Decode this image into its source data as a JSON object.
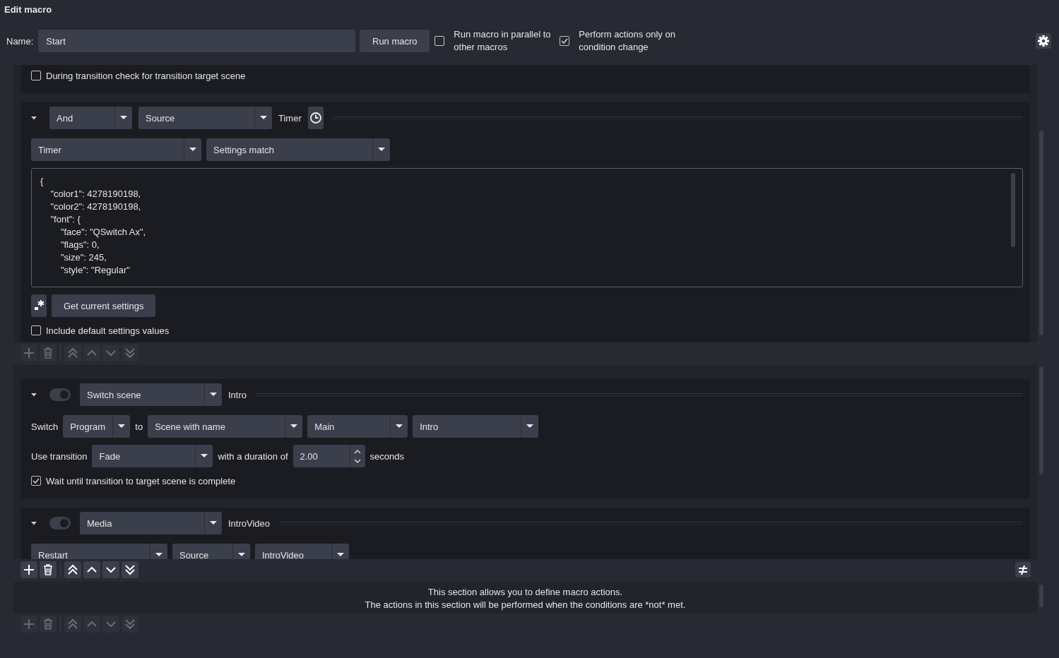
{
  "window": {
    "title": "Edit macro"
  },
  "header": {
    "name_label": "Name:",
    "name_value": "Start",
    "run_button": "Run macro",
    "options": [
      {
        "label": "Run macro in parallel to other macros",
        "checked": false
      },
      {
        "label": "Perform actions only on condition change",
        "checked": true
      }
    ]
  },
  "sections": [
    {
      "kind": "list",
      "panels": [
        {
          "rows": [
            {
              "items": [
                {
                  "kind": "checkbox",
                  "label": "During transition check for transition target scene",
                  "checked": false
                }
              ]
            }
          ]
        },
        {
          "expanded": true,
          "header": [
            {
              "kind": "combo",
              "value": "And"
            },
            {
              "kind": "combo",
              "value": "Source"
            },
            {
              "kind": "label",
              "text": "Timer"
            },
            {
              "kind": "timer"
            }
          ],
          "rows": [
            {
              "items": [
                {
                  "kind": "combo",
                  "value": "Timer"
                },
                {
                  "kind": "combo",
                  "value": "Settings match"
                }
              ]
            },
            {
              "items": [
                {
                  "kind": "text_area",
                  "lines": [
                    "{",
                    "    \"color1\": 4278190198,",
                    "    \"color2\": 4278190198,",
                    "    \"font\": {",
                    "        \"face\": \"QSwitch Ax\",",
                    "        \"flags\": 0,",
                    "        \"size\": 245,",
                    "        \"style\": \"Regular\""
                  ]
                }
              ]
            },
            {
              "items": [
                {
                  "kind": "regex"
                },
                {
                  "kind": "button",
                  "label": "Get current settings"
                }
              ]
            },
            {
              "items": [
                {
                  "kind": "checkbox",
                  "label": "Include default settings values",
                  "checked": false
                }
              ]
            }
          ]
        }
      ],
      "toolbar": {
        "enabled": false
      }
    },
    {
      "kind": "list",
      "panels": [
        {
          "expanded": true,
          "toggle": {
            "on": true
          },
          "header": [
            {
              "kind": "combo",
              "value": "Switch scene"
            },
            {
              "kind": "label",
              "text": "Intro"
            }
          ],
          "rows": [
            {
              "items": [
                {
                  "kind": "label",
                  "text": "Switch"
                },
                {
                  "kind": "combo",
                  "value": "Program"
                },
                {
                  "kind": "label",
                  "text": "to"
                },
                {
                  "kind": "combo",
                  "value": "Scene with name"
                },
                {
                  "kind": "combo",
                  "value": "Main"
                },
                {
                  "kind": "combo",
                  "value": "Intro"
                }
              ]
            },
            {
              "items": [
                {
                  "kind": "label",
                  "text": "Use transition"
                },
                {
                  "kind": "combo",
                  "value": "Fade"
                },
                {
                  "kind": "label",
                  "text": "with a duration of"
                },
                {
                  "kind": "spin",
                  "value": "2.00"
                },
                {
                  "kind": "label",
                  "text": "seconds"
                }
              ]
            },
            {
              "items": [
                {
                  "kind": "checkbox",
                  "label": "Wait until transition to target scene is complete",
                  "checked": true
                }
              ]
            }
          ]
        },
        {
          "expanded": true,
          "toggle": {
            "on": true
          },
          "header": [
            {
              "kind": "combo",
              "value": "Media"
            },
            {
              "kind": "label",
              "text": "IntroVideo"
            }
          ],
          "rows": [
            {
              "items": [
                {
                  "kind": "combo",
                  "value": "Restart"
                },
                {
                  "kind": "combo",
                  "value": "Source"
                },
                {
                  "kind": "combo",
                  "value": "IntroVideo"
                }
              ]
            }
          ]
        }
      ],
      "toolbar": {
        "enabled": true,
        "condition_toggle": true
      }
    },
    {
      "kind": "info",
      "lines": [
        "This section allows you to define macro actions.",
        "The actions in this section will be performed when the conditions are *not* met."
      ],
      "toolbar": {
        "enabled": false
      }
    }
  ]
}
